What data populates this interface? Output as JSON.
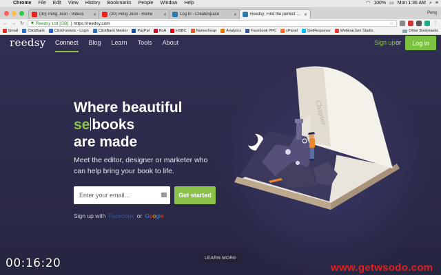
{
  "menubar": {
    "apple": "",
    "app": "Chrome",
    "items": [
      "File",
      "Edit",
      "View",
      "History",
      "Bookmarks",
      "People",
      "Window",
      "Help"
    ],
    "battery": "100%",
    "clock": "Mon 1:36 AM"
  },
  "tabs": [
    {
      "title": "(30) Peng Joon - Videos",
      "favicon_color": "#e62117",
      "active": false
    },
    {
      "title": "(30) Peng Joon - Home",
      "favicon_color": "#e62117",
      "active": false
    },
    {
      "title": "Log In - CreateSpace",
      "favicon_color": "#2a7ab0",
      "active": false
    },
    {
      "title": "Reedsy: Find the perfect edito",
      "favicon_color": "#2a7ab0",
      "active": true
    }
  ],
  "profile_name": "Peng",
  "address": {
    "secure_label": "Reedsy Ltd [GB]",
    "url": "https://reedsy.com"
  },
  "bookmarks": [
    {
      "label": "Gmail",
      "color": "#d93025"
    },
    {
      "label": "ClickBank",
      "color": "#2a6ebb"
    },
    {
      "label": "ClickFunnels - Login",
      "color": "#2b62c9"
    },
    {
      "label": "ClickBank Master",
      "color": "#2a6ebb"
    },
    {
      "label": "PayPal",
      "color": "#1b4fa0"
    },
    {
      "label": "BoA",
      "color": "#c41230"
    },
    {
      "label": "HSBC",
      "color": "#db0011"
    },
    {
      "label": "Namecheap",
      "color": "#de5c2c"
    },
    {
      "label": "Analytics",
      "color": "#e37400"
    },
    {
      "label": "Facebook PPC",
      "color": "#3b5998"
    },
    {
      "label": "cPanel",
      "color": "#ff6c2c"
    },
    {
      "label": "GetResponse",
      "color": "#00baff"
    },
    {
      "label": "WebinarJam Studio",
      "color": "#e03a3a"
    }
  ],
  "bookmarks_other": "Other Bookmarks",
  "site": {
    "logo": "reedsy",
    "nav": [
      "Connect",
      "Blog",
      "Learn",
      "Tools",
      "About"
    ],
    "signup": "Sign up",
    "or": "or",
    "login": "Log in",
    "hero_line1": "Where beautiful",
    "hero_typed": "se",
    "hero_rest": "books",
    "hero_line3": "are made",
    "subtitle": "Meet the editor, designer or marketer who can help bring your book to life.",
    "email_placeholder": "Enter your email...",
    "cta": "Get started",
    "signup_with": "Sign up with",
    "facebook": "Facebook",
    "or2": "or",
    "google": [
      "G",
      "o",
      "o",
      "g",
      "l",
      "e"
    ],
    "learn_more": "LEARN MORE",
    "book_chapter": "Chapter",
    "brand_green": "#8bc34a",
    "bg_color": "#2c2b4a"
  },
  "overlay": {
    "timer": "00:16:20",
    "watermark": "www.getwsodo.com"
  }
}
